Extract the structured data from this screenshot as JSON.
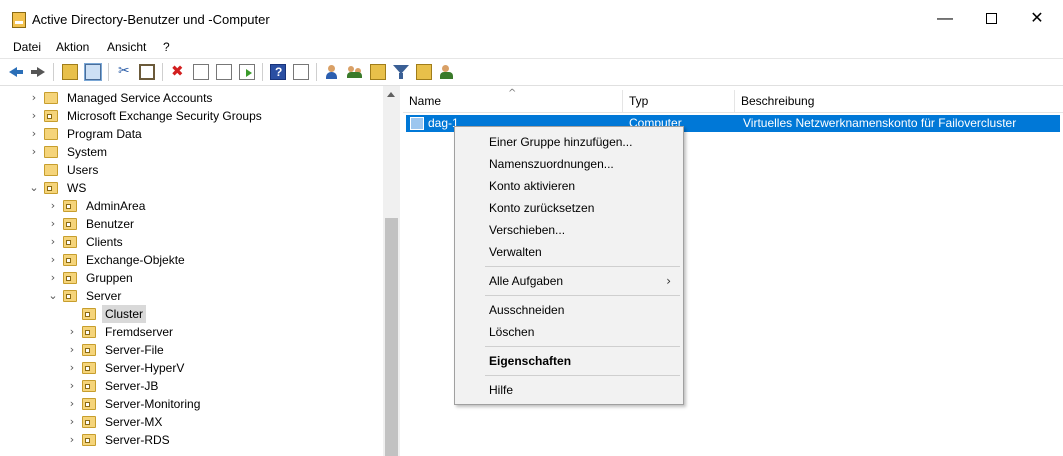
{
  "window": {
    "title": "Active Directory-Benutzer und -Computer",
    "minimize": "—",
    "close": "✕"
  },
  "menubar": [
    {
      "label": "Datei"
    },
    {
      "label": "Aktion"
    },
    {
      "label": "Ansicht"
    },
    {
      "label": "?"
    }
  ],
  "toolbar": {
    "icons": [
      "arrow-left-icon",
      "arrow-right-icon",
      "up-folder-icon",
      "console-tree-icon",
      "cut-icon",
      "copy-icon",
      "delete-icon",
      "properties-icon",
      "refresh-icon",
      "export-list-icon",
      "help-icon",
      "show-pane-icon",
      "new-user-icon",
      "new-group-icon",
      "new-ou-icon",
      "filter-icon",
      "find-icon",
      "delegate-icon"
    ]
  },
  "tree": {
    "items": [
      {
        "label": "Managed Service Accounts",
        "depth": 1,
        "expander": "›",
        "icon": "folder"
      },
      {
        "label": "Microsoft Exchange Security Groups",
        "depth": 1,
        "expander": "›",
        "icon": "ou"
      },
      {
        "label": "Program Data",
        "depth": 1,
        "expander": "›",
        "icon": "folder"
      },
      {
        "label": "System",
        "depth": 1,
        "expander": "›",
        "icon": "folder"
      },
      {
        "label": "Users",
        "depth": 1,
        "expander": "",
        "icon": "folder"
      },
      {
        "label": "WS",
        "depth": 1,
        "expander": "⌄",
        "icon": "ou"
      },
      {
        "label": "AdminArea",
        "depth": 2,
        "expander": "›",
        "icon": "ou"
      },
      {
        "label": "Benutzer",
        "depth": 2,
        "expander": "›",
        "icon": "ou"
      },
      {
        "label": "Clients",
        "depth": 2,
        "expander": "›",
        "icon": "ou"
      },
      {
        "label": "Exchange-Objekte",
        "depth": 2,
        "expander": "›",
        "icon": "ou"
      },
      {
        "label": "Gruppen",
        "depth": 2,
        "expander": "›",
        "icon": "ou"
      },
      {
        "label": "Server",
        "depth": 2,
        "expander": "⌄",
        "icon": "ou"
      },
      {
        "label": "Cluster",
        "depth": 3,
        "expander": "",
        "icon": "ou",
        "selected": true
      },
      {
        "label": "Fremdserver",
        "depth": 3,
        "expander": "›",
        "icon": "ou"
      },
      {
        "label": "Server-File",
        "depth": 3,
        "expander": "›",
        "icon": "ou"
      },
      {
        "label": "Server-HyperV",
        "depth": 3,
        "expander": "›",
        "icon": "ou"
      },
      {
        "label": "Server-JB",
        "depth": 3,
        "expander": "›",
        "icon": "ou"
      },
      {
        "label": "Server-Monitoring",
        "depth": 3,
        "expander": "›",
        "icon": "ou"
      },
      {
        "label": "Server-MX",
        "depth": 3,
        "expander": "›",
        "icon": "ou"
      },
      {
        "label": "Server-RDS",
        "depth": 3,
        "expander": "›",
        "icon": "ou"
      }
    ]
  },
  "list": {
    "columns": [
      {
        "label": "Name"
      },
      {
        "label": "Typ"
      },
      {
        "label": "Beschreibung"
      }
    ],
    "sort_indicator": "^",
    "rows": [
      {
        "name": "dag-1",
        "type": "Computer",
        "description": "Virtuelles Netzwerknamenskonto für Failovercluster",
        "selected": true
      }
    ]
  },
  "context_menu": {
    "items": [
      {
        "label": "Einer Gruppe hinzufügen..."
      },
      {
        "label": "Namenszuordnungen..."
      },
      {
        "label": "Konto aktivieren"
      },
      {
        "label": "Konto zurücksetzen"
      },
      {
        "label": "Verschieben..."
      },
      {
        "label": "Verwalten"
      },
      {
        "separator": true
      },
      {
        "label": "Alle Aufgaben",
        "submenu": "›"
      },
      {
        "separator": true
      },
      {
        "label": "Ausschneiden"
      },
      {
        "label": "Löschen"
      },
      {
        "separator": true
      },
      {
        "label": "Eigenschaften",
        "bold": true
      },
      {
        "separator": true
      },
      {
        "label": "Hilfe"
      }
    ]
  },
  "colors": {
    "selection": "#0078d7",
    "tree_selection": "#d9d9d9",
    "menu_bg": "#f2f2f2"
  }
}
